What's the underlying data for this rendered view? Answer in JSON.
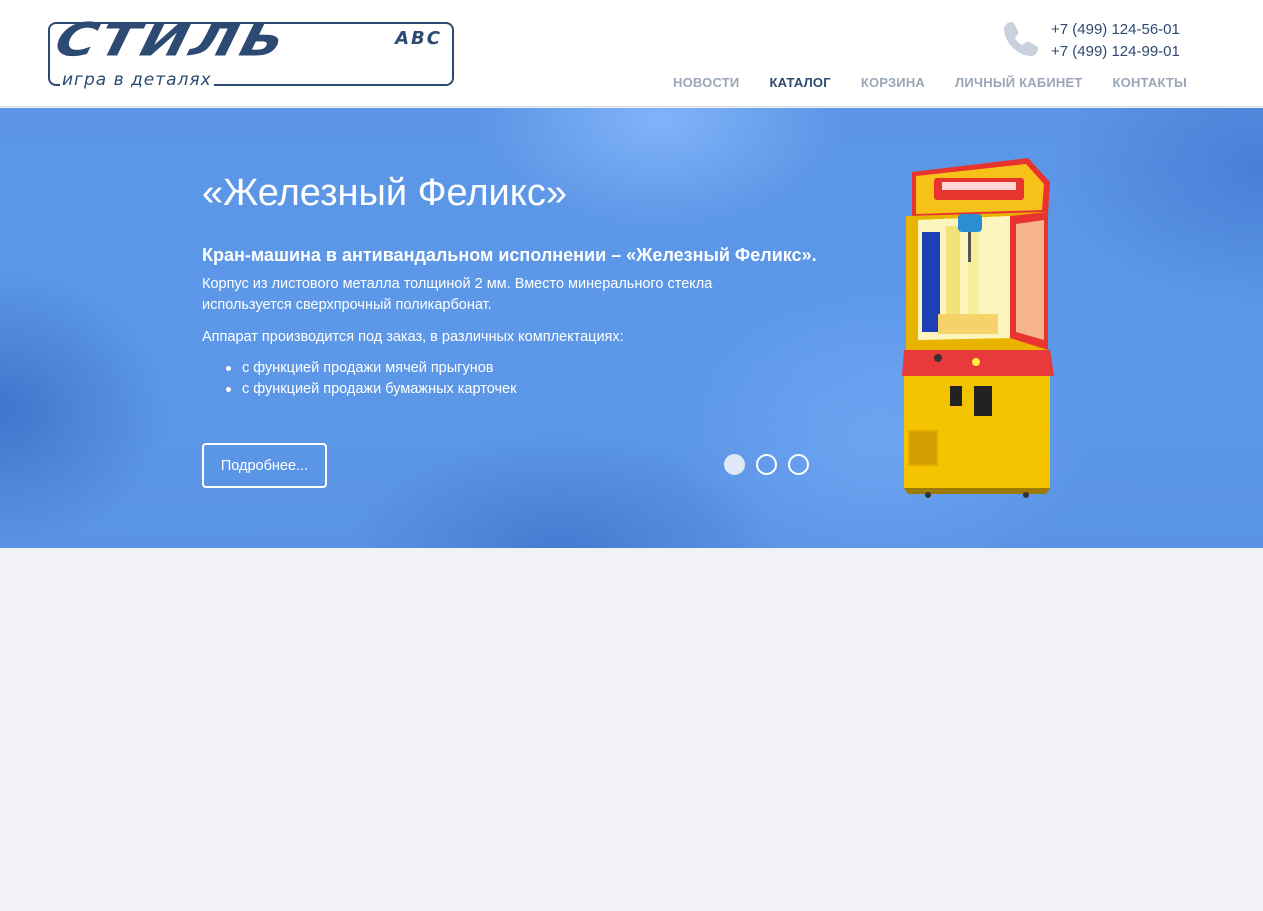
{
  "header": {
    "logo": {
      "word": "СТИЛЬ",
      "abc": "ABC",
      "tagline": "игра в деталях"
    },
    "phones": [
      "+7 (499) 124-56-01",
      "+7 (499) 124-99-01"
    ],
    "nav": [
      {
        "label": "НОВОСТИ",
        "active": false
      },
      {
        "label": "КАТАЛОГ",
        "active": true
      },
      {
        "label": "КОРЗИНА",
        "active": false
      },
      {
        "label": "ЛИЧНЫЙ КАБИНЕТ",
        "active": false
      },
      {
        "label": "КОНТАКТЫ",
        "active": false
      }
    ]
  },
  "hero": {
    "title": "«Железный Феликс»",
    "subtitle": "Кран-машина в антивандальном исполнении – «Железный Феликс».",
    "paragraph1": "Корпус из листового металла толщиной 2 мм. Вместо минерального стекла используется сверхпрочный поликарбонат.",
    "paragraph2": "Аппарат производится под заказ, в различных комплектациях:",
    "list": [
      "с функцией продажи мячей прыгунов",
      "с функцией продажи бумажных карточек"
    ],
    "button_label": "Подробнее...",
    "slides_total": 3,
    "slide_active": 1
  },
  "colors": {
    "brand": "#2d4a72",
    "nav_inactive": "#9aa7b8",
    "hero_blue": "#5c95e6",
    "page_bg": "#f0f2f6"
  },
  "icons": [
    "phone-icon"
  ]
}
